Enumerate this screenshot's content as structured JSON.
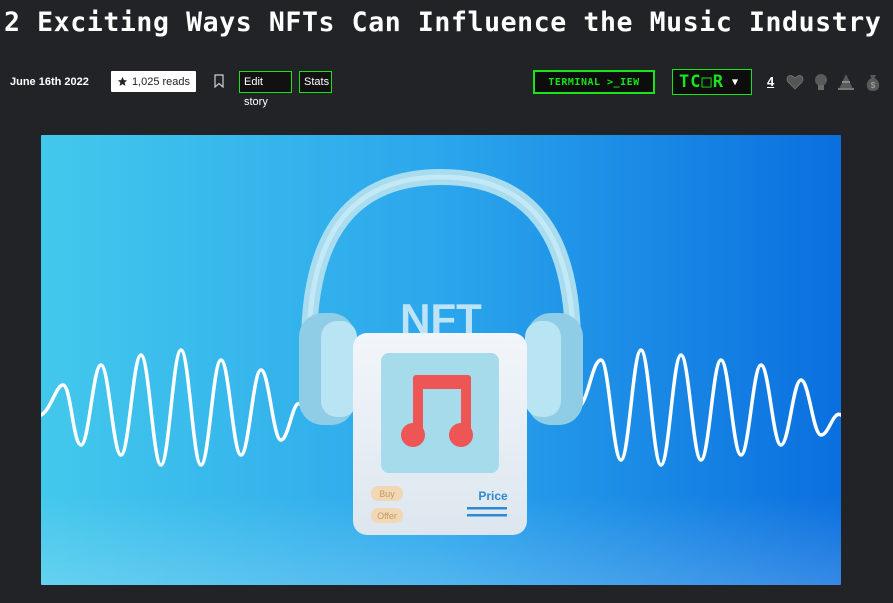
{
  "article": {
    "title": "2 Exciting Ways NFTs Can Influence the Music Industry",
    "date": "June 16th 2022",
    "reads": "1,025 reads",
    "edit_label": "Edit story",
    "stats_label": "Stats"
  },
  "badges": {
    "terminal_label": "TERMINAL >_IEW",
    "tcdr_label": "TC□R",
    "tcdr_caret": "▼"
  },
  "reactions": {
    "count": "4",
    "icons": [
      "heart-icon",
      "lightbulb-icon",
      "cone-icon",
      "money-bag-icon"
    ]
  },
  "hero": {
    "nft_text": "NFT",
    "buy_label": "Buy",
    "offer_label": "Offer",
    "price_label": "Price"
  },
  "colors": {
    "accent_green": "#19e319",
    "background": "#222326"
  }
}
